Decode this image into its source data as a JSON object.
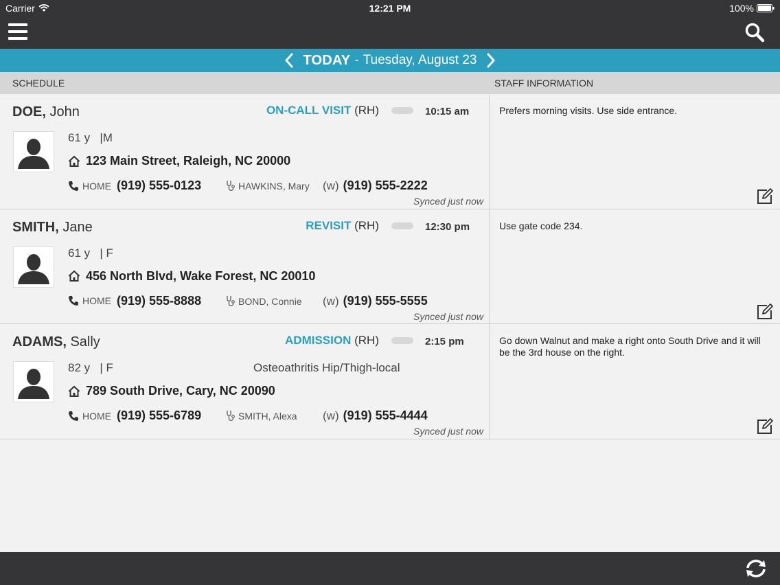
{
  "status_bar": {
    "carrier": "Carrier",
    "time": "12:21 PM",
    "battery": "100%"
  },
  "header": {
    "menu_icon": "hamburger-menu-icon",
    "search_icon": "search-icon"
  },
  "date_nav": {
    "today": "TODAY",
    "separator": "-",
    "date": "Tuesday, August 23"
  },
  "columns": {
    "schedule": "SCHEDULE",
    "staff_info": "STAFF INFORMATION"
  },
  "visits": [
    {
      "last_name": "DOE,",
      "first_name": "John",
      "visit_type": "ON-CALL VISIT",
      "visit_code": "(RH)",
      "time": "10:15 am",
      "age": "61 y",
      "sex": "|M",
      "diagnosis": "",
      "address": "123 Main Street, Raleigh, NC 20000",
      "phone_label": "HOME",
      "phone": "(919) 555-0123",
      "staff": "HAWKINS, Mary",
      "work_label": "(w)",
      "work_phone": "(919) 555-2222",
      "synced": "Synced just now",
      "note": "Prefers morning visits. Use side entrance."
    },
    {
      "last_name": "SMITH,",
      "first_name": "Jane",
      "visit_type": "REVISIT",
      "visit_code": "(RH)",
      "time": "12:30 pm",
      "age": "61 y",
      "sex": "| F",
      "diagnosis": "",
      "address": "456 North Blvd, Wake Forest, NC 20010",
      "phone_label": "HOME",
      "phone": "(919) 555-8888",
      "staff": "BOND, Connie",
      "work_label": "(w)",
      "work_phone": "(919) 555-5555",
      "synced": "Synced just now",
      "note": "Use gate code 234."
    },
    {
      "last_name": "ADAMS,",
      "first_name": "Sally",
      "visit_type": "ADMISSION",
      "visit_code": "(RH)",
      "time": "2:15 pm",
      "age": "82 y",
      "sex": "| F",
      "diagnosis": "Osteoathritis Hip/Thigh-local",
      "address": "789 South Drive, Cary, NC 20090",
      "phone_label": "HOME",
      "phone": "(919) 555-6789",
      "staff": "SMITH, Alexa",
      "work_label": "(w)",
      "work_phone": "(919) 555-4444",
      "synced": "Synced just now",
      "note": "Go down Walnut and make a right onto South Drive and it will be the 3rd house on the right."
    }
  ],
  "footer": {
    "refresh_icon": "refresh-icon"
  },
  "colors": {
    "accent": "#2c9fbe",
    "bar": "#353538",
    "header_row": "#d6d6d6"
  }
}
